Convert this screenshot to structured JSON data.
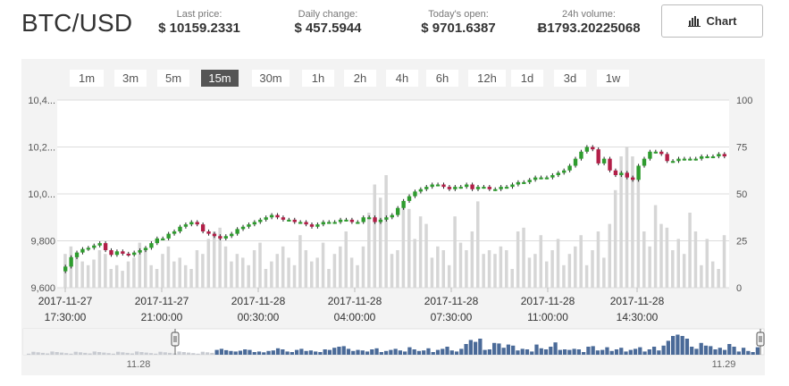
{
  "pair": "BTC/USD",
  "stats": [
    {
      "label": "Last price:",
      "value": "$ 10159.2331"
    },
    {
      "label": "Daily change:",
      "value": "$ 457.5944"
    },
    {
      "label": "Today's open:",
      "value": "$ 9701.6387"
    },
    {
      "label": "24h volume:",
      "value": "Ƀ1793.20225068"
    }
  ],
  "chart_button": {
    "label": "Chart",
    "icon": "bar-chart-icon"
  },
  "ranges": [
    "1m",
    "3m",
    "5m",
    "15m",
    "30m",
    "1h",
    "2h",
    "4h",
    "6h",
    "12h",
    "1d",
    "3d",
    "1w"
  ],
  "active_range": "15m",
  "colors": {
    "up": "#2e9c2e",
    "down": "#b21f48",
    "volume": "#d6d6d6",
    "navigator": "#4a6a98"
  },
  "navigator": {
    "start_label": "11.28",
    "end_label": "11.29"
  },
  "chart_data": {
    "type": "candlestick",
    "price_axis": {
      "ticks": [
        "9,600",
        "9,800",
        "10,0...",
        "10,2...",
        "10,4..."
      ],
      "ylim": [
        9600,
        10400
      ]
    },
    "volume_axis": {
      "ticks": [
        "0",
        "25",
        "50",
        "75",
        "100"
      ],
      "ylim": [
        0,
        100
      ]
    },
    "x_ticks": [
      {
        "date": "2017-11-27",
        "time": "17:30:00"
      },
      {
        "date": "2017-11-27",
        "time": "21:00:00"
      },
      {
        "date": "2017-11-28",
        "time": "00:30:00"
      },
      {
        "date": "2017-11-28",
        "time": "04:00:00"
      },
      {
        "date": "2017-11-28",
        "time": "07:30:00"
      },
      {
        "date": "2017-11-28",
        "time": "11:00:00"
      },
      {
        "date": "2017-11-28",
        "time": "14:30:00"
      }
    ],
    "close": [
      9690,
      9730,
      9750,
      9765,
      9770,
      9780,
      9790,
      9760,
      9740,
      9755,
      9745,
      9740,
      9750,
      9760,
      9770,
      9790,
      9810,
      9810,
      9830,
      9840,
      9860,
      9870,
      9880,
      9870,
      9840,
      9830,
      9820,
      9810,
      9820,
      9830,
      9850,
      9860,
      9870,
      9880,
      9890,
      9900,
      9910,
      9900,
      9890,
      9890,
      9880,
      9880,
      9870,
      9860,
      9870,
      9880,
      9880,
      9880,
      9890,
      9890,
      9880,
      9880,
      9900,
      9900,
      9880,
      9890,
      9900,
      9910,
      9940,
      9970,
      9990,
      10010,
      10020,
      10030,
      10040,
      10040,
      10030,
      10020,
      10030,
      10030,
      10040,
      10020,
      10030,
      10030,
      10020,
      10020,
      10030,
      10030,
      10040,
      10050,
      10050,
      10060,
      10070,
      10070,
      10070,
      10080,
      10090,
      10100,
      10120,
      10150,
      10180,
      10200,
      10190,
      10130,
      10150,
      10100,
      10080,
      10090,
      10070,
      10060,
      10120,
      10150,
      10180,
      10180,
      10170,
      10140,
      10140,
      10150,
      10150,
      10150,
      10150,
      10160,
      10160,
      10160,
      10170,
      10160
    ],
    "volume": [
      18,
      22,
      17,
      14,
      12,
      15,
      20,
      18,
      10,
      12,
      9,
      14,
      16,
      24,
      20,
      12,
      10,
      18,
      22,
      14,
      16,
      12,
      10,
      20,
      18,
      26,
      30,
      32,
      22,
      14,
      18,
      16,
      12,
      20,
      24,
      10,
      14,
      18,
      22,
      16,
      12,
      28,
      20,
      14,
      16,
      24,
      10,
      18,
      22,
      30,
      16,
      12,
      22,
      40,
      55,
      48,
      60,
      18,
      20,
      44,
      42,
      26,
      38,
      34,
      16,
      22,
      20,
      12,
      38,
      24,
      20,
      30,
      46,
      18,
      20,
      18,
      22,
      20,
      10,
      30,
      32,
      16,
      18,
      28,
      14,
      20,
      26,
      12,
      18,
      22,
      28,
      12,
      20,
      30,
      16,
      34,
      52,
      70,
      75,
      70,
      60,
      30,
      22,
      44,
      34,
      32,
      20,
      26,
      18,
      40,
      30,
      12,
      26,
      14,
      10,
      28
    ]
  }
}
